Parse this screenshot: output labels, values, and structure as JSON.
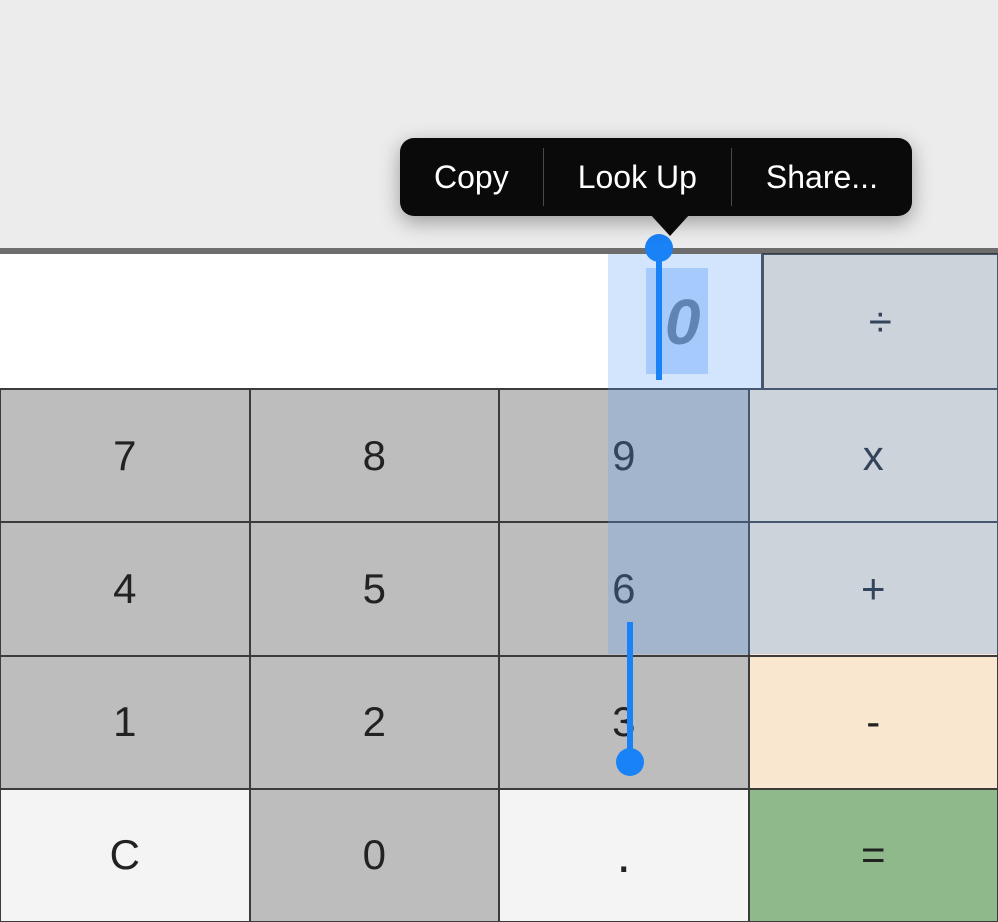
{
  "display": {
    "value": "0"
  },
  "operators": {
    "divide": "÷",
    "multiply": "x",
    "plus": "+",
    "minus": "-",
    "equals": "="
  },
  "keys": {
    "k7": "7",
    "k8": "8",
    "k9": "9",
    "k4": "4",
    "k5": "5",
    "k6": "6",
    "k1": "1",
    "k2": "2",
    "k3": "3",
    "clear": "C",
    "k0": "0",
    "dot": "."
  },
  "context_menu": {
    "copy": "Copy",
    "lookup": "Look Up",
    "share": "Share..."
  }
}
